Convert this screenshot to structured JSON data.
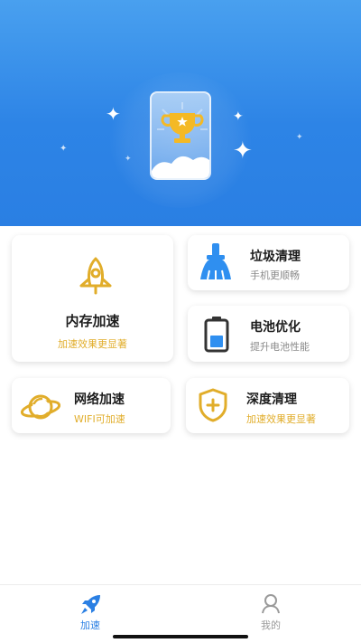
{
  "cards": {
    "memory_boost": {
      "title": "内存加速",
      "subtitle": "加速效果更显著"
    },
    "junk_clean": {
      "title": "垃圾清理",
      "subtitle": "手机更顺畅"
    },
    "battery_optimize": {
      "title": "电池优化",
      "subtitle": "提升电池性能"
    },
    "network_boost": {
      "title": "网络加速",
      "subtitle": "WIFI可加速"
    },
    "deep_clean": {
      "title": "深度清理",
      "subtitle": "加速效果更显著"
    }
  },
  "tabbar": {
    "tabs": [
      {
        "label": "加速",
        "icon": "rocket-icon",
        "active": true
      },
      {
        "label": "我的",
        "icon": "user-icon",
        "active": false
      }
    ]
  },
  "colors": {
    "hero_blue": "#2d84e6",
    "accent_gold": "#e1ad2a",
    "broom_blue": "#2f8ff0",
    "active_tab": "#2a7fe3",
    "inactive_tab": "#9a9a9a"
  }
}
